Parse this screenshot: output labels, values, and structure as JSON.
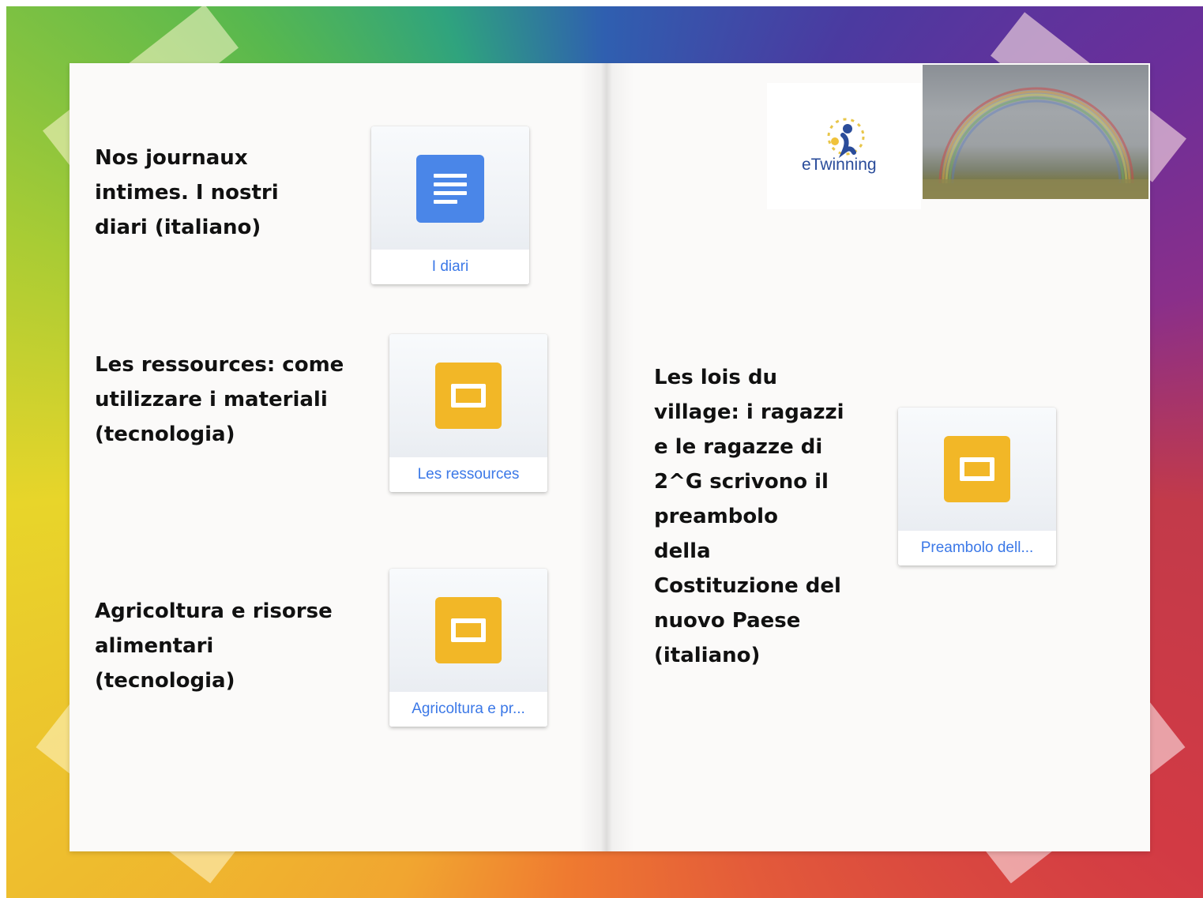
{
  "page": {
    "left": {
      "sections": [
        {
          "text": "Nos journaux\nintimes. I nostri\ndiari (italiano)",
          "link": {
            "label": "I diari",
            "icon": "google-docs-icon"
          }
        },
        {
          "text": "Les ressources: come\nutilizzare i materiali\n(tecnologia)",
          "link": {
            "label": "Les ressources",
            "icon": "google-slides-icon"
          }
        },
        {
          "text": "Agricoltura e risorse\nalimentari\n(tecnologia)",
          "link": {
            "label": "Agricoltura e pr...",
            "icon": "google-slides-icon"
          }
        }
      ]
    },
    "right": {
      "logo": {
        "text": "eTwinning"
      },
      "photo": {
        "subject": "rainbow"
      },
      "sections": [
        {
          "text": "Les lois du\nvillage: i ragazzi\ne le ragazze di\n2^G scrivono il\npreambolo\ndella\nCostituzione del\nnuovo Paese\n(italiano)",
          "link": {
            "label": "Preambolo dell...",
            "icon": "google-slides-icon"
          }
        }
      ]
    }
  },
  "colors": {
    "docs_blue": "#4a86e8",
    "slides_yellow": "#f2b727",
    "link_blue": "#3b78e7",
    "page_background": "#fbfaf9"
  }
}
